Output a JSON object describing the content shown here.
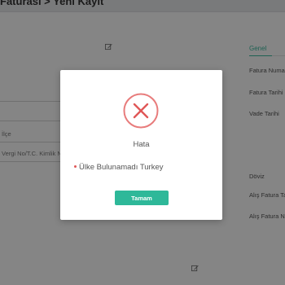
{
  "header": {
    "breadcrumb": "Faturası > Yeni Kayıt"
  },
  "form": {
    "ilce_label": "İlçe",
    "vergi_label": "Vergi No/T.C. Kimlik No"
  },
  "right_panel": {
    "tab_genel": "Genel",
    "fatura_numarasi": "Fatura Numarası",
    "fatura_tarihi": "Fatura Tarihi",
    "vade_tarihi": "Vade Tarihi",
    "doviz": "Döviz",
    "alis_fatura_tarihi": "Alış Fatura Tarihi",
    "alis_fatura_no": "Alış Fatura No"
  },
  "dialog": {
    "title": "Hata",
    "message": "Ülke Bulunamadı Turkey",
    "ok_label": "Tamam"
  },
  "colors": {
    "accent": "#2eb899",
    "error": "#e05757",
    "overlay": "rgba(0,0,0,0.48)"
  },
  "icons": [
    "edit-icon",
    "error-x-icon",
    "bullet-icon"
  ]
}
